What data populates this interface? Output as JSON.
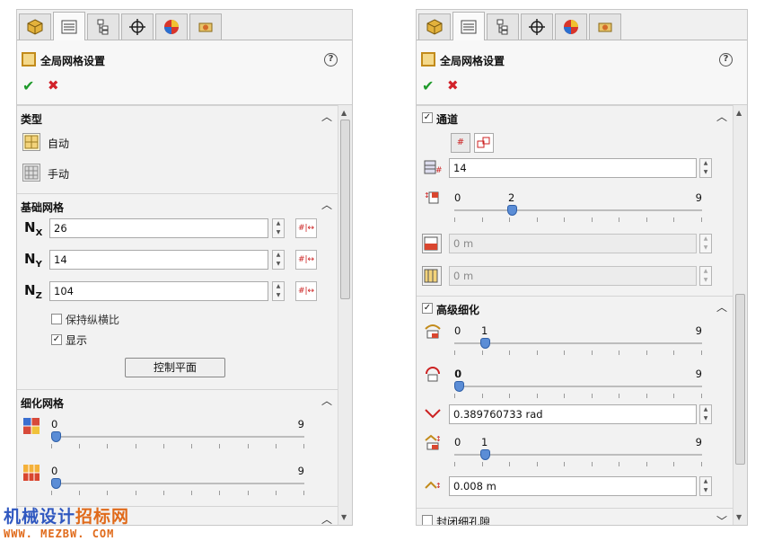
{
  "left": {
    "tabs": [
      "geometry-tab",
      "feature-tab",
      "config-tab",
      "origin-tab",
      "appearance-tab",
      "mesh-tab"
    ],
    "header": {
      "title": "全局网格设置",
      "help": "?",
      "ok": "✔",
      "cancel": "✖"
    },
    "type_section": {
      "title": "类型",
      "auto": "自动",
      "manual": "手动"
    },
    "basic_section": {
      "title": "基础网格",
      "nx_label": "N",
      "nx_sub": "X",
      "nx_value": "26",
      "ny_label": "N",
      "ny_sub": "Y",
      "ny_value": "14",
      "nz_label": "N",
      "nz_sub": "Z",
      "nz_value": "104",
      "keep_ratio": "保持纵横比",
      "keep_ratio_checked": false,
      "show": "显示",
      "show_checked": true,
      "control_plane_button": "控制平面"
    },
    "refine_section": {
      "title": "细化网格",
      "slider1": {
        "min": "0",
        "max": "9",
        "value": 0
      },
      "slider2": {
        "min": "0",
        "max": "9",
        "value": 0
      }
    }
  },
  "right": {
    "header": {
      "title": "全局网格设置",
      "help": "?",
      "ok": "✔",
      "cancel": "✖"
    },
    "channel_section": {
      "title": "通道",
      "checked": true,
      "count_value": "14",
      "slider": {
        "min": "0",
        "max": "9",
        "value": 2,
        "value_label": "2"
      },
      "width1": "0 m",
      "width2": "0 m"
    },
    "advanced_section": {
      "title": "高级细化",
      "checked": true,
      "slider1": {
        "min": "0",
        "max": "9",
        "value": 1,
        "value_label": "1"
      },
      "slider2": {
        "min": "0",
        "max": "9",
        "value": 0,
        "value_label": "0"
      },
      "angle_value": "0.389760733 rad",
      "slider3": {
        "min": "0",
        "max": "9",
        "value": 1,
        "value_label": "1"
      },
      "size_value": "0.008 m"
    },
    "closed_gap": {
      "title": "封闭细孔隙",
      "checked": false
    }
  },
  "watermark": {
    "line1_a": "机械设计",
    "line1_b": "招标网",
    "line2": "WWW. MEZBW. COM"
  }
}
